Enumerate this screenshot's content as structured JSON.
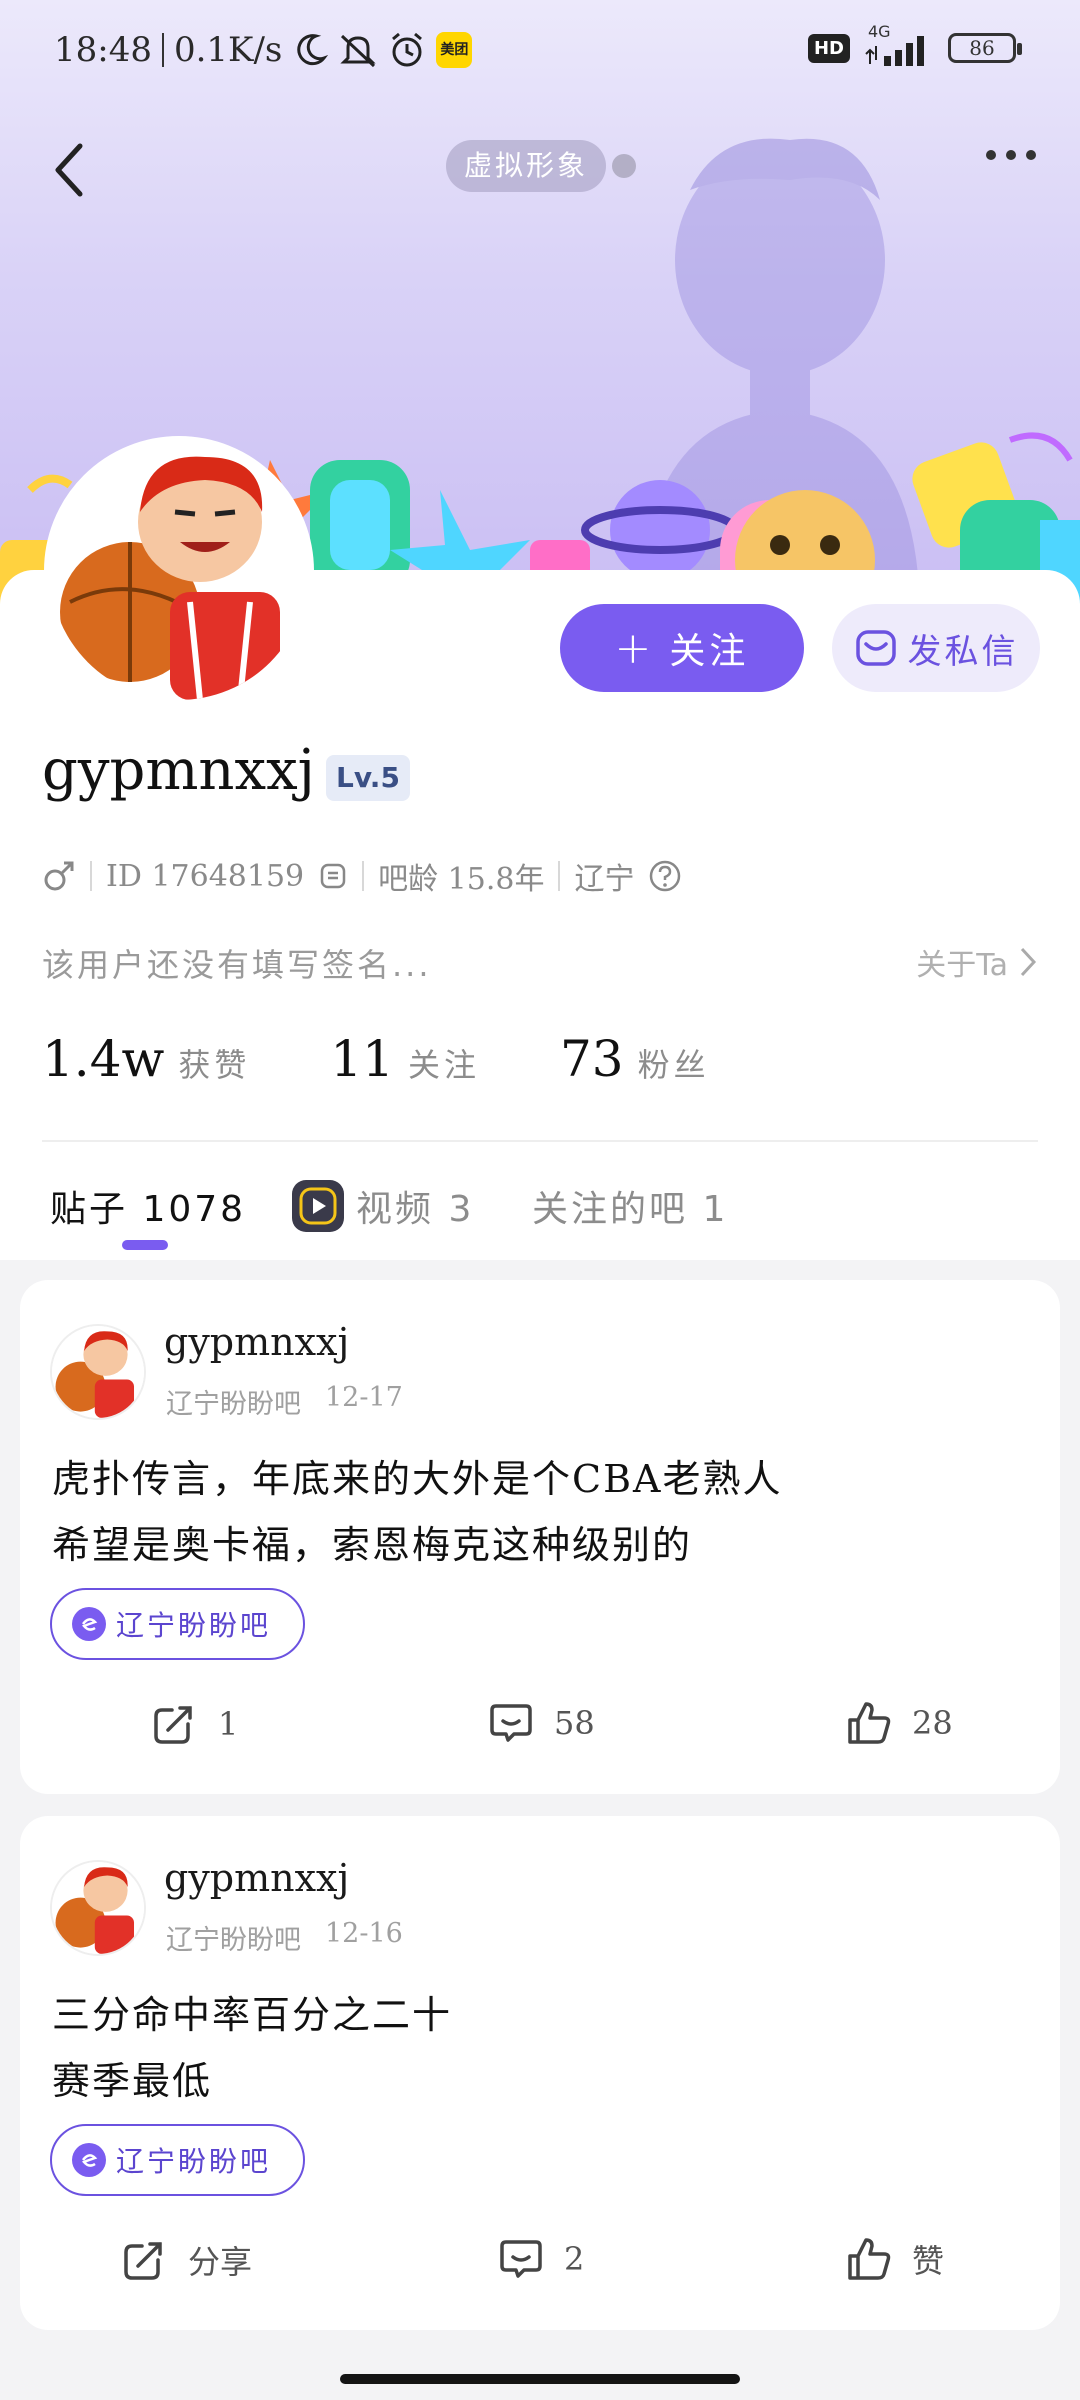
{
  "status_bar": {
    "time": "18:48",
    "speed": "0.1K/s",
    "meituan_label": "美团",
    "network": "4G",
    "hd_label": "HD",
    "battery": "86"
  },
  "header": {
    "avatar_tag": "虚拟形象"
  },
  "profile": {
    "follow_label": "关注",
    "follow_plus": "+",
    "dm_label": "发私信",
    "username": "gypmnxxj",
    "level": "Lv.5",
    "id_text": "ID 17648159",
    "bar_age": "吧龄 15.8年",
    "region": "辽宁",
    "signature": "该用户还没有填写签名...",
    "about_label": "关于Ta",
    "stats": [
      {
        "num": "1.4w",
        "label": "获赞"
      },
      {
        "num": "11",
        "label": "关注"
      },
      {
        "num": "73",
        "label": "粉丝"
      }
    ]
  },
  "tabs": [
    {
      "label": "贴子 1078"
    },
    {
      "label": "视频 3"
    },
    {
      "label": "关注的吧 1"
    }
  ],
  "posts": [
    {
      "author": "gypmnxxj",
      "forum": "辽宁盼盼吧",
      "date": "12-17",
      "lines": [
        "虎扑传言，年底来的大外是个CBA老熟人",
        "希望是奥卡福，索恩梅克这种级别的"
      ],
      "chip": "辽宁盼盼吧",
      "share": "1",
      "comments": "58",
      "likes": "28"
    },
    {
      "author": "gypmnxxj",
      "forum": "辽宁盼盼吧",
      "date": "12-16",
      "lines": [
        "三分命中率百分之二十",
        "赛季最低"
      ],
      "chip": "辽宁盼盼吧",
      "share": "分享",
      "comments": "2",
      "likes": "赞"
    }
  ],
  "colors": {
    "accent": "#7a5cf0",
    "banner_top": "#ece9fb",
    "banner_bottom": "#c9bdf3"
  }
}
